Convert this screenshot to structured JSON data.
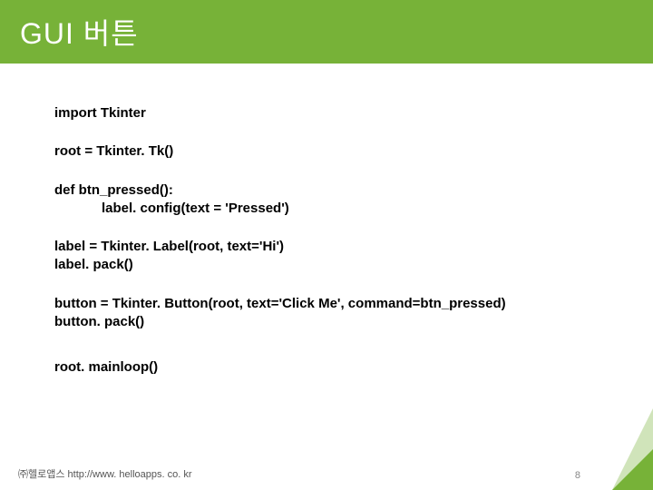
{
  "header": {
    "title": "GUI 버튼"
  },
  "code": {
    "l1": "import Tkinter",
    "l2": "root = Tkinter. Tk()",
    "l3": "def btn_pressed():",
    "l4": "label. config(text = 'Pressed')",
    "l5": "label = Tkinter. Label(root, text='Hi')",
    "l6": "label. pack()",
    "l7": "button = Tkinter. Button(root, text='Click Me', command=btn_pressed)",
    "l8": "button. pack()",
    "l9": "root. mainloop()"
  },
  "footer": {
    "company": "㈜헬로앱스  http://www. helloapps. co. kr",
    "page": "8"
  }
}
